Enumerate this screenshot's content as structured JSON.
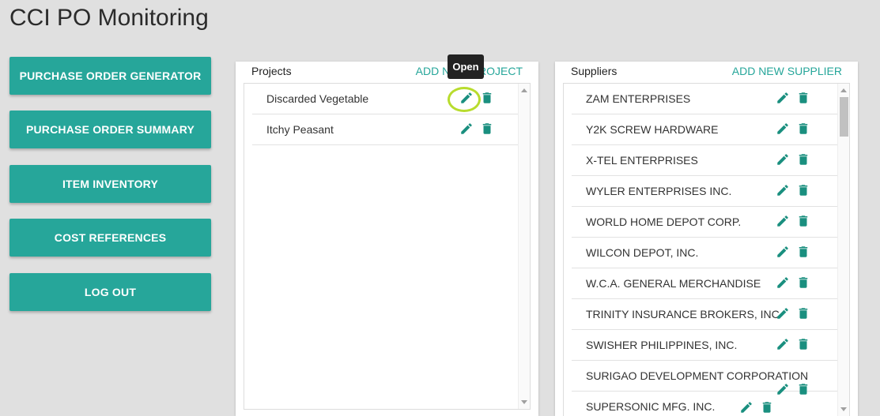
{
  "app": {
    "title": "CCI PO Monitoring"
  },
  "nav": [
    {
      "label": "PURCHASE ORDER GENERATOR"
    },
    {
      "label": "PURCHASE ORDER SUMMARY"
    },
    {
      "label": "ITEM INVENTORY"
    },
    {
      "label": "COST REFERENCES"
    },
    {
      "label": "LOG OUT"
    }
  ],
  "projects": {
    "title": "Projects",
    "add_link": "ADD NEW PROJECT",
    "items": [
      {
        "name": "Discarded Vegetable"
      },
      {
        "name": "Itchy Peasant"
      }
    ]
  },
  "suppliers": {
    "title": "Suppliers",
    "add_link": "ADD NEW SUPPLIER",
    "items": [
      {
        "name": "ZAM ENTERPRISES"
      },
      {
        "name": "Y2K SCREW HARDWARE"
      },
      {
        "name": "X-TEL ENTERPRISES"
      },
      {
        "name": "WYLER ENTERPRISES INC."
      },
      {
        "name": "WORLD HOME DEPOT CORP."
      },
      {
        "name": "WILCON DEPOT, INC."
      },
      {
        "name": "W.C.A. GENERAL MERCHANDISE"
      },
      {
        "name": "TRINITY INSURANCE BROKERS, INC"
      },
      {
        "name": "SWISHER PHILIPPINES, INC."
      },
      {
        "name": "SURIGAO DEVELOPMENT CORPORATION"
      },
      {
        "name": "SUPERSONIC MFG. INC."
      }
    ]
  },
  "tooltip": {
    "text": "Open"
  },
  "colors": {
    "accent": "#26a69a",
    "highlight": "#b8dc2e"
  },
  "icons": {
    "edit": "pencil-icon",
    "delete": "trash-icon"
  }
}
